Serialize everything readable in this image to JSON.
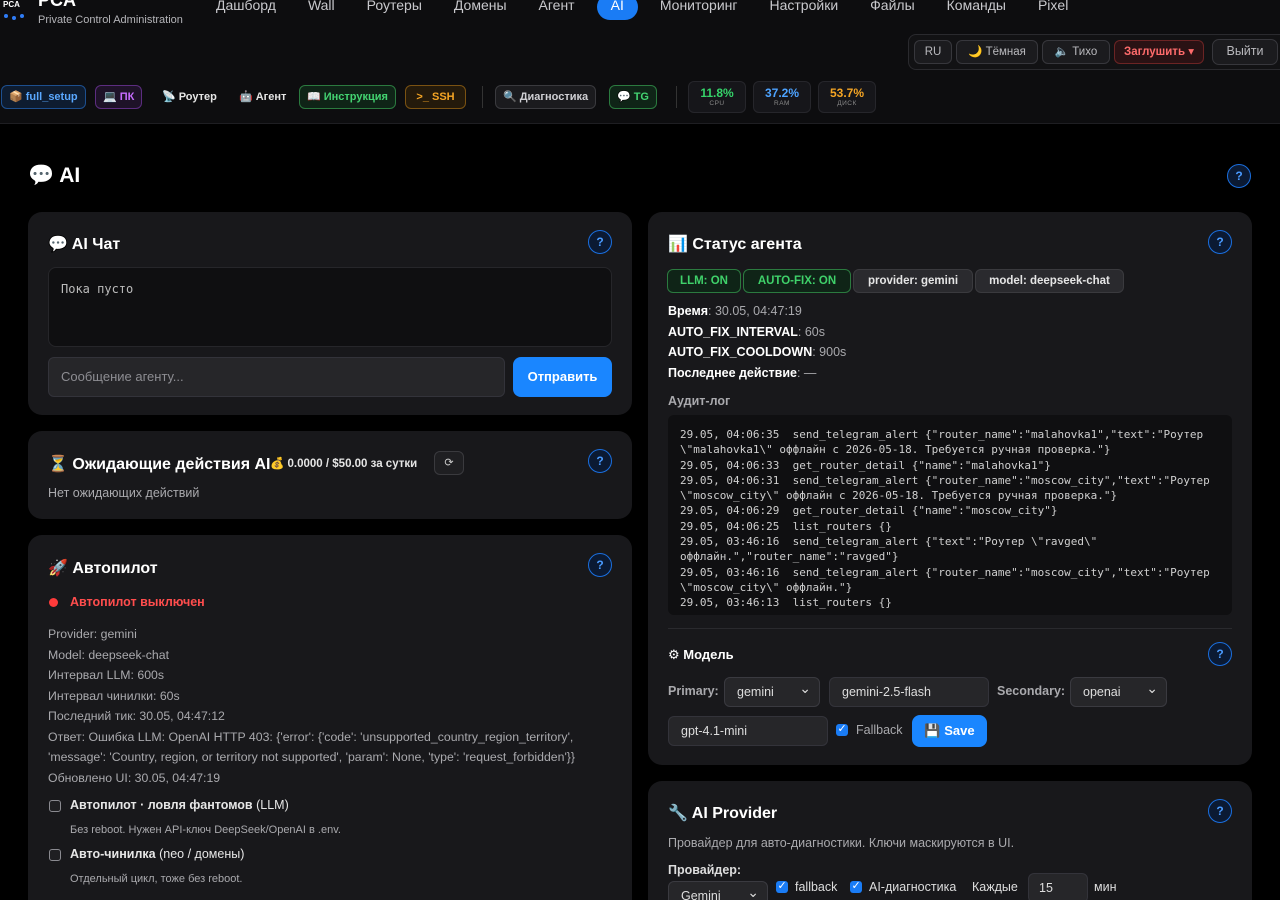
{
  "brand": {
    "logo_text": "PCA",
    "title": "PCA",
    "subtitle": "Private Control Administration"
  },
  "nav": [
    "Дашборд",
    "Wall",
    "Роутеры",
    "Домены",
    "Агент",
    "AI",
    "Мониторинг",
    "Настройки",
    "Файлы",
    "Команды",
    "Pixel"
  ],
  "nav_active": "AI",
  "controls": {
    "lang": "RU",
    "theme": "🌙 Тёмная",
    "sound": "🔈 Тихо",
    "mute": "Заглушить ▾",
    "logout": "Выйти"
  },
  "quickbar": {
    "full_setup": "full_setup",
    "pc": "ПК",
    "router": "Роутер",
    "agent": "Агент",
    "guide": "Инструкция",
    "ssh": ">_ SSH",
    "diag": "Диагностика",
    "tg": "TG"
  },
  "metrics": [
    {
      "value": "11.8%",
      "label": "CPU",
      "color": "#35d46a"
    },
    {
      "value": "37.2%",
      "label": "RAM",
      "color": "#4da3ff"
    },
    {
      "value": "53.7%",
      "label": "ДИСК",
      "color": "#f5a524"
    }
  ],
  "page": {
    "title": "💬 AI",
    "help": "?"
  },
  "chat": {
    "title": "💬 AI Чат",
    "empty": "Пока пусто",
    "placeholder": "Сообщение агенту...",
    "send": "Отправить"
  },
  "pending": {
    "title": "⏳ Ожидающие действия AI",
    "budget": "💰 0.0000 / $50.00 за сутки",
    "refresh": "⟳",
    "empty": "Нет ожидающих действий"
  },
  "autopilot": {
    "title": "🚀 Автопилот",
    "status": "Автопилот выключен",
    "lines": [
      "Provider: gemini",
      "Model: deepseek-chat",
      "Интервал LLM: 600s",
      "Интервал чинилки: 60s",
      "Последний тик: 30.05, 04:47:12",
      "Ответ: Ошибка LLM: OpenAI HTTP 403: {'error': {'code': 'unsupported_country_region_territory',",
      "'message': 'Country, region, or territory not supported', 'param': None, 'type': 'request_forbidden'}}",
      "Обновлено UI: 30.05, 04:47:19"
    ],
    "options": [
      {
        "label": "Автопилот · ловля фантомов",
        "suffix": " (LLM)",
        "hint": "Без reboot. Нужен API-ключ DeepSeek/OpenAI в .env."
      },
      {
        "label": "Авто-чинилка",
        "suffix": " (neo / домены)",
        "hint": "Отдельный цикл, тоже без reboot."
      }
    ]
  },
  "status": {
    "title": "📊 Статус агента",
    "badges": [
      "LLM: ON",
      "AUTO-FIX: ON",
      "provider: gemini",
      "model: deepseek-chat"
    ],
    "time_key": "Время",
    "time_val": ": 30.05, 04:47:19",
    "interval_key": "AUTO_FIX_INTERVAL",
    "interval_val": ": 60s",
    "cooldown_key": "AUTO_FIX_COOLDOWN",
    "cooldown_val": ": 900s",
    "last_key": "Последнее действие",
    "last_val": ": —",
    "audit_title": "Аудит-лог",
    "audit": [
      "29.05, 04:06:35  send_telegram_alert {\"router_name\":\"malahovka1\",\"text\":\"Роутер \\\"malahovka1\\\" оффлайн с 2026-05-18. Требуется ручная проверка.\"}",
      "29.05, 04:06:33  get_router_detail {\"name\":\"malahovka1\"}",
      "29.05, 04:06:31  send_telegram_alert {\"router_name\":\"moscow_city\",\"text\":\"Роутер \\\"moscow_city\\\" оффлайн с 2026-05-18. Требуется ручная проверка.\"}",
      "29.05, 04:06:29  get_router_detail {\"name\":\"moscow_city\"}",
      "29.05, 04:06:25  list_routers {}",
      "29.05, 03:46:16  send_telegram_alert {\"text\":\"Роутер \\\"ravged\\\" оффлайн.\",\"router_name\":\"ravged\"}",
      "29.05, 03:46:16  send_telegram_alert {\"router_name\":\"moscow_city\",\"text\":\"Роутер \\\"moscow_city\\\" оффлайн.\"}",
      "29.05, 03:46:13  list_routers {}"
    ]
  },
  "model": {
    "title": "⚙ Модель",
    "primary_label": "Primary:",
    "primary": "gemini",
    "primary_model": "gemini-2.5-flash",
    "secondary_label": "Secondary:",
    "secondary": "openai",
    "secondary_model": "gpt-4.1-mini",
    "fallback": "Fallback",
    "save": "💾 Save"
  },
  "provider": {
    "title": "🔧 AI Provider",
    "desc": "Провайдер для авто-диагностики. Ключи маскируются в UI.",
    "label": "Провайдер:",
    "value": "Gemini",
    "fallback": "fallback",
    "diag": "AI-диагностика",
    "every": "Каждые",
    "minutes": "15",
    "unit": "мин"
  }
}
